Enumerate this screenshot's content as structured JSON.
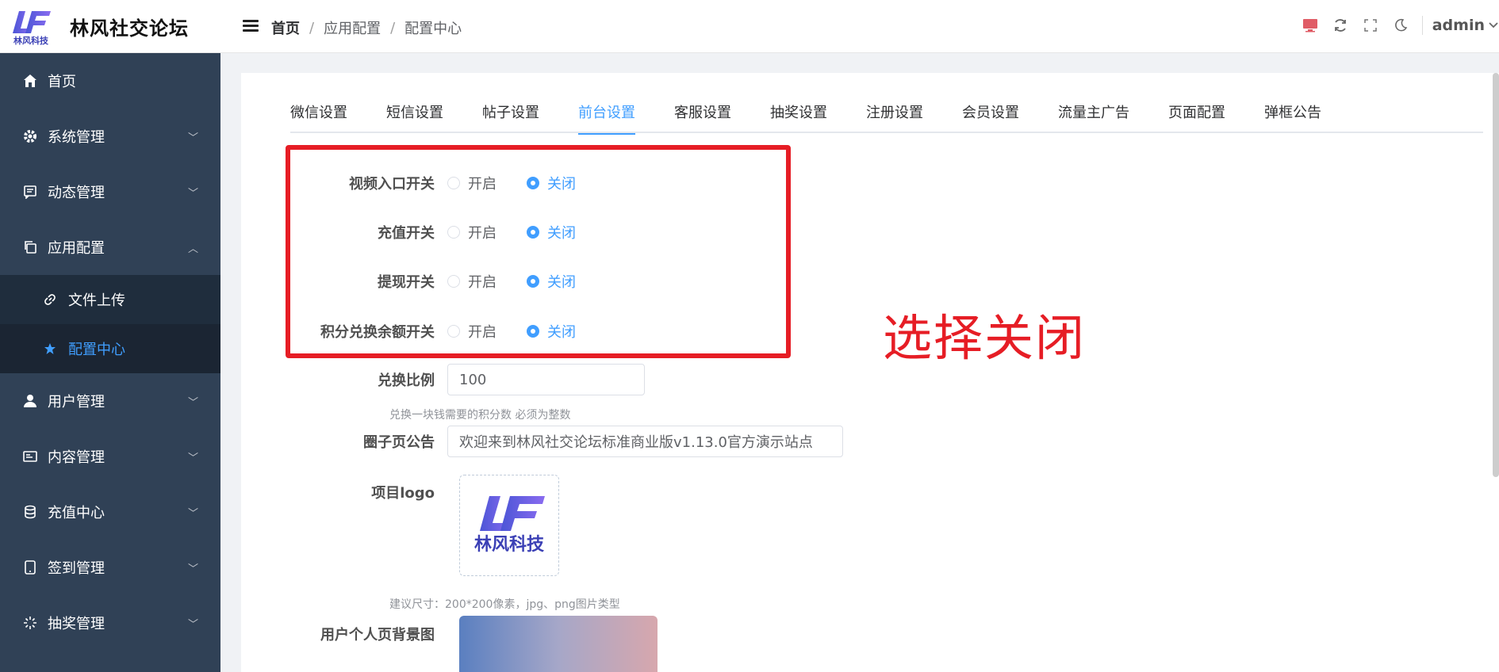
{
  "brand": {
    "logo_text": "LF",
    "logo_sub": "林风科技",
    "title": "林风社交论坛"
  },
  "breadcrumb": [
    "首页",
    "应用配置",
    "配置中心"
  ],
  "header": {
    "user": "admin"
  },
  "sidebar": {
    "items": [
      {
        "label": "首页",
        "icon": "home-icon",
        "has_children": false
      },
      {
        "label": "系统管理",
        "icon": "gear-icon",
        "has_children": true
      },
      {
        "label": "动态管理",
        "icon": "message-icon",
        "has_children": true
      },
      {
        "label": "应用配置",
        "icon": "copy-icon",
        "has_children": true,
        "expanded": true
      },
      {
        "label": "用户管理",
        "icon": "user-icon",
        "has_children": true
      },
      {
        "label": "内容管理",
        "icon": "card-icon",
        "has_children": true
      },
      {
        "label": "充值中心",
        "icon": "database-icon",
        "has_children": true
      },
      {
        "label": "签到管理",
        "icon": "tablet-icon",
        "has_children": true
      },
      {
        "label": "抽奖管理",
        "icon": "loading-icon",
        "has_children": true
      }
    ],
    "sub_items": [
      {
        "label": "文件上传",
        "icon": "link-icon",
        "active": false
      },
      {
        "label": "配置中心",
        "icon": "star-icon",
        "active": true
      }
    ]
  },
  "tabs": [
    "微信设置",
    "短信设置",
    "帖子设置",
    "前台设置",
    "客服设置",
    "抽奖设置",
    "注册设置",
    "会员设置",
    "流量主广告",
    "页面配置",
    "弹框公告"
  ],
  "active_tab": "前台设置",
  "form": {
    "switches": [
      {
        "label": "视频入口开关",
        "on_label": "开启",
        "off_label": "关闭",
        "selected": "关闭"
      },
      {
        "label": "充值开关",
        "on_label": "开启",
        "off_label": "关闭",
        "selected": "关闭"
      },
      {
        "label": "提现开关",
        "on_label": "开启",
        "off_label": "关闭",
        "selected": "关闭"
      },
      {
        "label": "积分兑换余额开关",
        "on_label": "开启",
        "off_label": "关闭",
        "selected": "关闭"
      }
    ],
    "ratio_label": "兑换比例",
    "ratio_value": "100",
    "ratio_hint": "兑换一块钱需要的积分数 必须为整数",
    "notice_label": "圈子页公告",
    "notice_value": "欢迎来到林风社交论坛标准商业版v1.13.0官方演示站点",
    "logo_label": "项目logo",
    "logo_hint": "建议尺寸：200*200像素，jpg、png图片类型",
    "bg_label": "用户个人页背景图"
  },
  "annotation": "选择关闭",
  "colors": {
    "accent": "#409eff",
    "sidebar_bg": "#304156",
    "annotation": "#e61d25"
  }
}
